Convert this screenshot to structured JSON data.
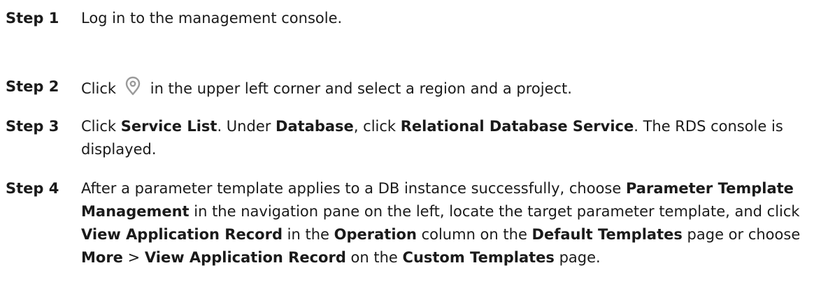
{
  "steps": [
    {
      "label": "Step 1",
      "text": "Log in to the management console."
    },
    {
      "label": "Step 2",
      "before_icon": "Click",
      "icon": "location-pin-icon",
      "after_icon": "in the upper left corner and select a region and a project."
    },
    {
      "label": "Step 3",
      "t1": "Click ",
      "b1": "Service List",
      "t2": ". Under ",
      "b2": "Database",
      "t3": ", click ",
      "b3": "Relational Database Service",
      "t4": ". The RDS console is displayed."
    },
    {
      "label": "Step 4",
      "t1": "After a parameter template applies to a DB instance successfully, choose ",
      "b1": "Parameter Template Management",
      "t2": " in the navigation pane on the left, locate the target parameter template, and click ",
      "b2": "View Application Record",
      "t3": " in the ",
      "b3": "Operation",
      "t4": " column on the ",
      "b4": "Default Templates",
      "t5": " page or choose ",
      "b5": "More",
      "t6": " > ",
      "b6": "View Application Record",
      "t7": " on the ",
      "b7": "Custom Templates",
      "t8": " page."
    }
  ],
  "icon_color": "#9a9a9a"
}
